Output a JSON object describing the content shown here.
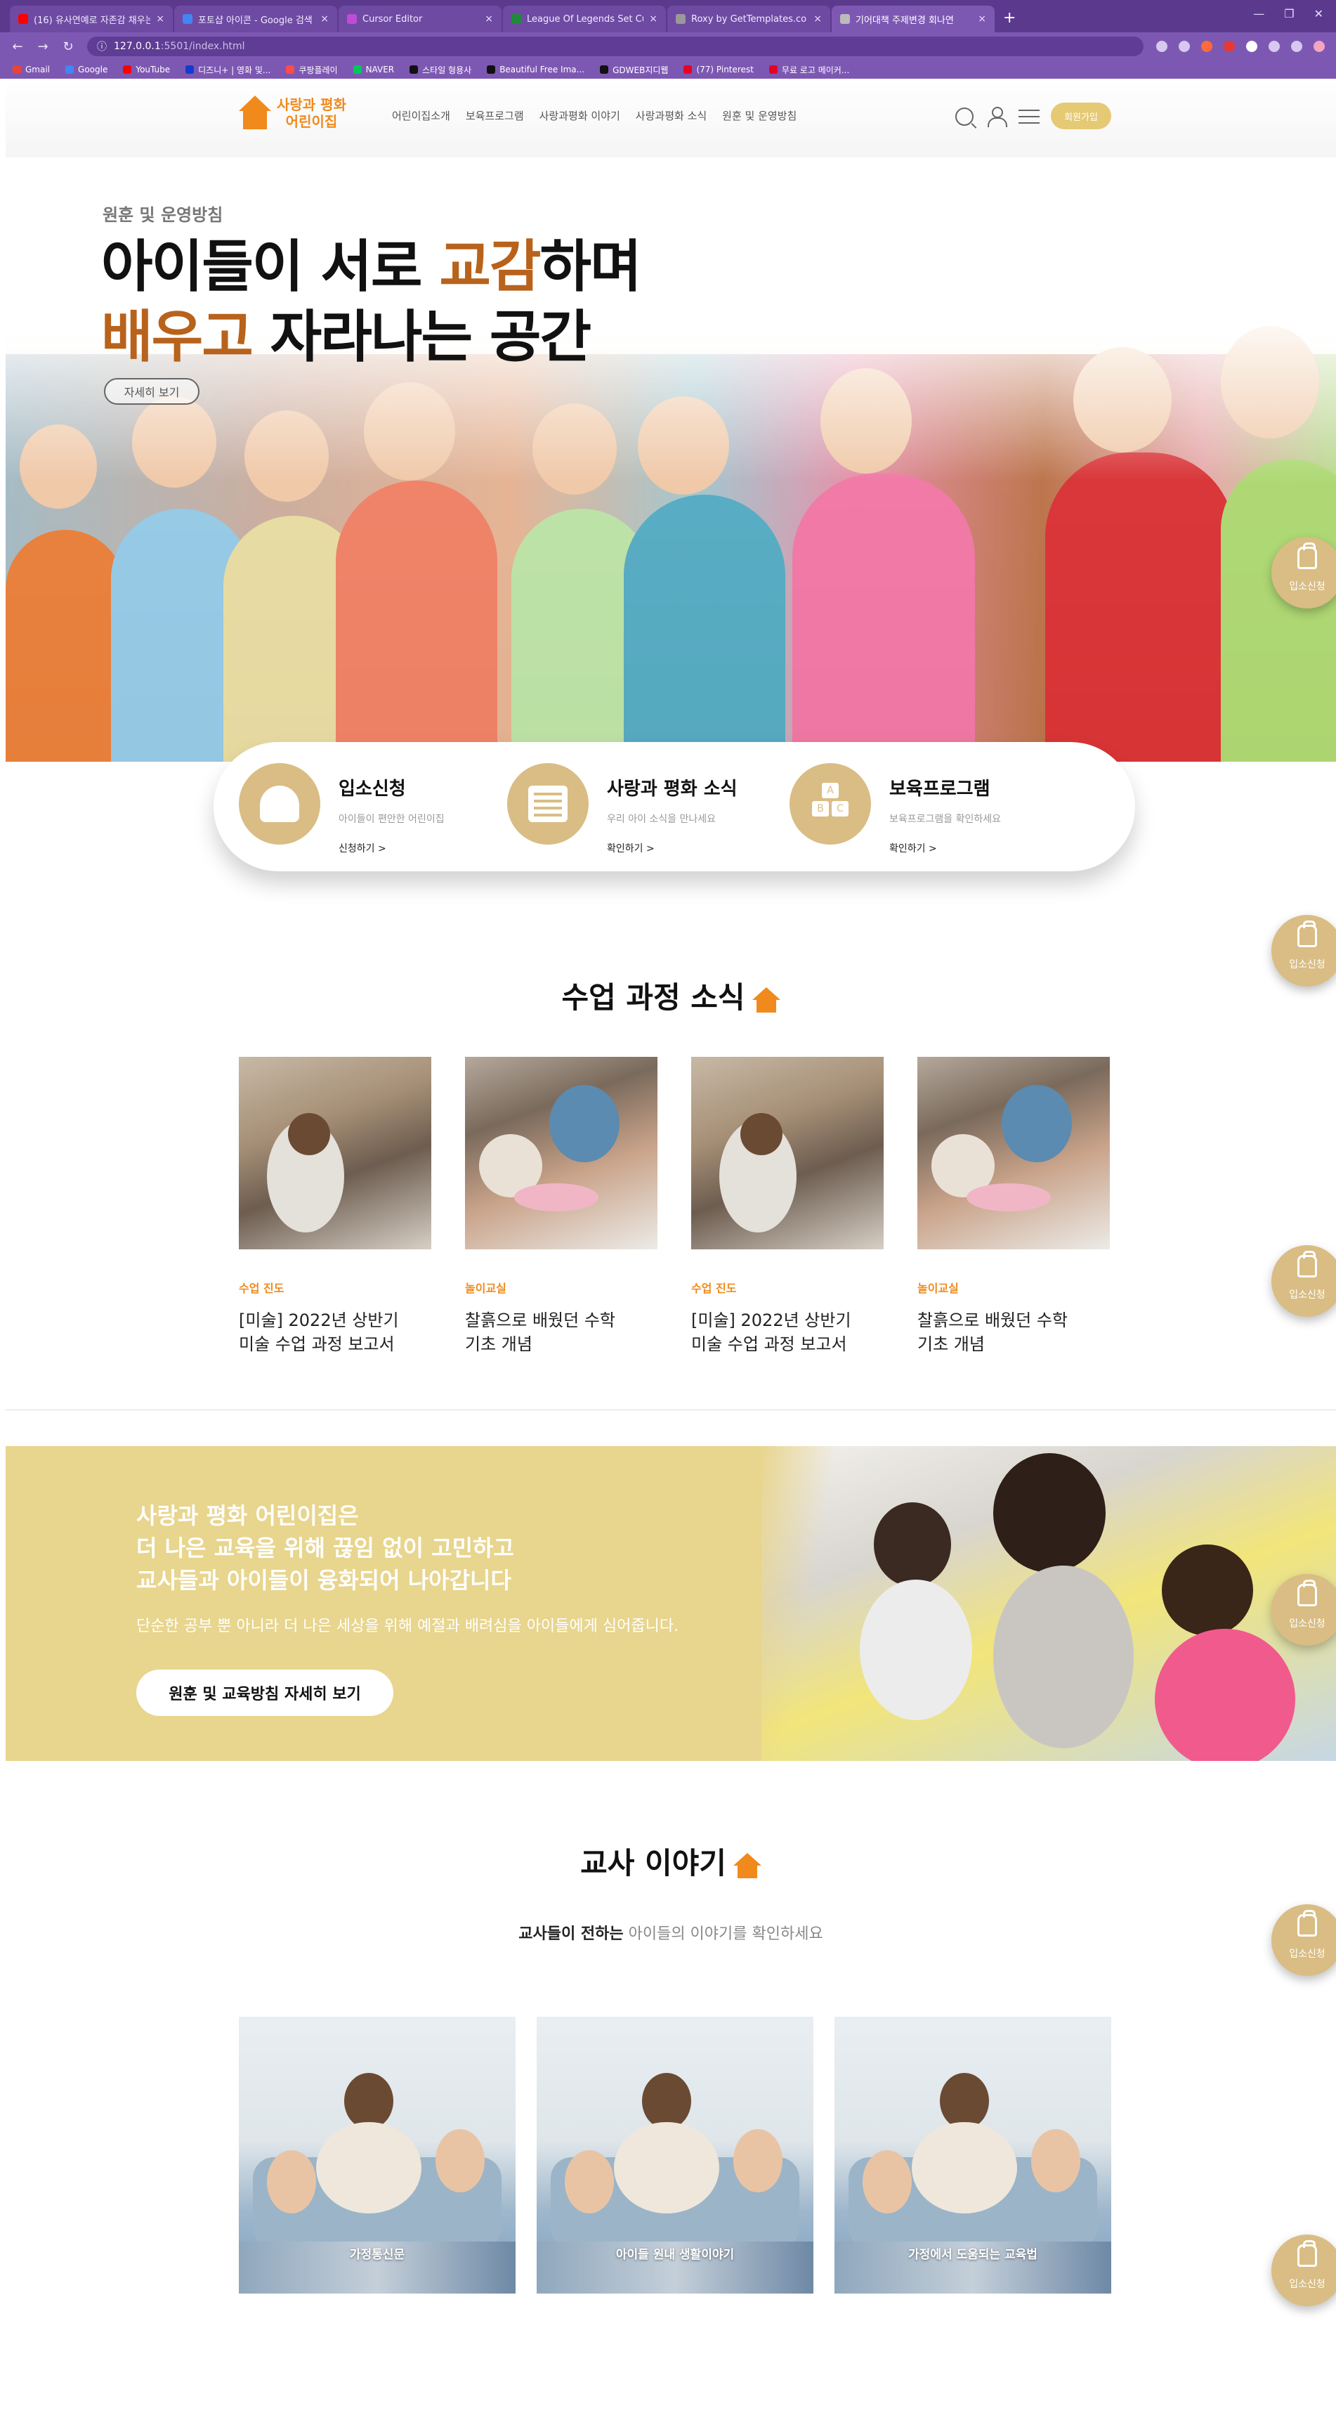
{
  "browser": {
    "tabs": [
      {
        "title": "(16) 유사연예로 자존감 채우는",
        "color": "#ff0000"
      },
      {
        "title": "포토샵 아이콘 - Google 검색",
        "color": "#4285f4"
      },
      {
        "title": "Cursor Editor",
        "color": "#c04bd6"
      },
      {
        "title": "League Of Legends Set Cursor",
        "color": "#1f8a3a"
      },
      {
        "title": "Roxy by GetTemplates.co",
        "color": "#999999"
      },
      {
        "title": "기어대책 주제변경 회나연",
        "color": "#bbbbbb"
      }
    ],
    "new_tab": "+",
    "url_host": "127.0.0.1",
    "url_path": ":5501/index.html",
    "bookmarks": [
      {
        "label": "Gmail",
        "color": "#ea4335"
      },
      {
        "label": "Google",
        "color": "#4285f4"
      },
      {
        "label": "YouTube",
        "color": "#ff0000"
      },
      {
        "label": "디즈니+ | 영화 및...",
        "color": "#113ccf"
      },
      {
        "label": "쿠팡플레이",
        "color": "#ff4b4b"
      },
      {
        "label": "NAVER",
        "color": "#03c75a"
      },
      {
        "label": "스타일 형용사",
        "color": "#111111"
      },
      {
        "label": "Beautiful Free Ima...",
        "color": "#111111"
      },
      {
        "label": "GDWEB지디웹",
        "color": "#111111"
      },
      {
        "label": "(77) Pinterest",
        "color": "#e60023"
      },
      {
        "label": "무료 로고 메이커...",
        "color": "#e60023"
      }
    ]
  },
  "header": {
    "logo_line1": "사랑과 평화",
    "logo_line2": "어린이집",
    "nav": [
      "어린이집소개",
      "보육프로그램",
      "사랑과평화 이야기",
      "사랑과평화 소식",
      "원훈 및 운영방침"
    ],
    "join_label": "회원가입"
  },
  "hero": {
    "subtitle": "원훈 및 운영방침",
    "title_l1_a": "아이들이 서로 ",
    "title_l1_hl": "교감",
    "title_l1_b": "하며",
    "title_l2_hl": "배우고",
    "title_l2_b": " 자라나는 공간",
    "button": "자세히 보기"
  },
  "quick": [
    {
      "title": "입소신청",
      "desc": "아이들이 편안한 어린이집",
      "link": "신청하기 >",
      "icon": "graduate-icon"
    },
    {
      "title": "사랑과 평화 소식",
      "desc": "우리 아이 소식을 만나세요",
      "link": "확인하기 >",
      "icon": "newspaper-icon"
    },
    {
      "title": "보육프로그램",
      "desc": "보육프로그램을 확인하세요",
      "link": "확인하기 >",
      "icon": "abc-blocks-icon"
    }
  ],
  "float_apply_label": "입소신청",
  "class_news": {
    "title": "수업 과정 소식",
    "cards": [
      {
        "category": "수업 진도",
        "title_l1": "[미술] 2022년 상반기",
        "title_l2": "미술 수업 과정 보고서"
      },
      {
        "category": "놀이교실",
        "title_l1": "찰흙으로 배웠던 수학",
        "title_l2": "기초 개념"
      },
      {
        "category": "수업 진도",
        "title_l1": "[미술] 2022년 상반기",
        "title_l2": "미술 수업 과정 보고서"
      },
      {
        "category": "놀이교실",
        "title_l1": "찰흙으로 배웠던 수학",
        "title_l2": "기초 개념"
      }
    ]
  },
  "banner": {
    "line1": "사랑과 평화 어린이집은",
    "line2": "더 나은 교육을 위해 끊임 없이 고민하고",
    "line3": "교사들과 아이들이 융화되어 나아갑니다",
    "desc": "단순한 공부 뿐 아니라 더 나은 세상을 위해 예절과 배려심을 아이들에게 심어줍니다.",
    "button": "원훈 및 교육방침 자세히 보기"
  },
  "teacher": {
    "title": "교사 이야기",
    "sub_bold": "교사들이 전하는",
    "sub_rest": " 아이들의 이야기를 확인하세요",
    "cards": [
      "가정통신문",
      "아이들 원내 생활이야기",
      "가정에서 도움되는 교육법"
    ]
  }
}
